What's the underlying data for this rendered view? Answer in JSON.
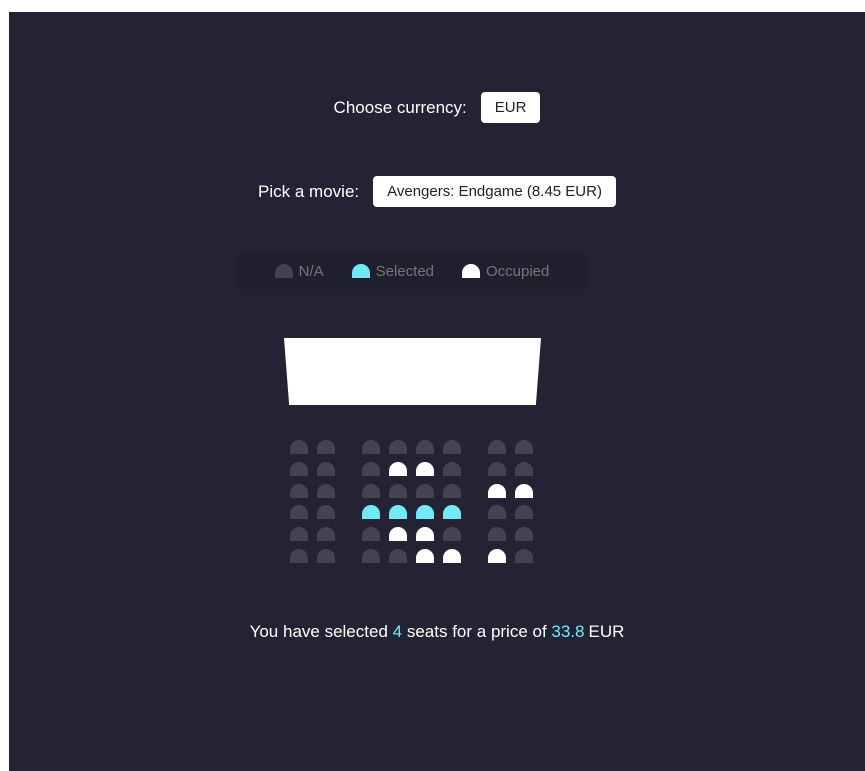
{
  "currency": {
    "label": "Choose currency:",
    "value": "EUR"
  },
  "movie": {
    "label": "Pick a movie:",
    "value": "Avengers: Endgame (8.45 EUR)"
  },
  "legend": [
    {
      "label": "N/A",
      "status": "na"
    },
    {
      "label": "Selected",
      "status": "selected"
    },
    {
      "label": "Occupied",
      "status": "occupied"
    }
  ],
  "seats": [
    [
      "na",
      "na",
      "na",
      "na",
      "na",
      "na",
      "na",
      "na"
    ],
    [
      "na",
      "na",
      "na",
      "occupied",
      "occupied",
      "na",
      "na",
      "na"
    ],
    [
      "na",
      "na",
      "na",
      "na",
      "na",
      "na",
      "occupied",
      "occupied"
    ],
    [
      "na",
      "na",
      "selected",
      "selected",
      "selected",
      "selected",
      "na",
      "na"
    ],
    [
      "na",
      "na",
      "na",
      "occupied",
      "occupied",
      "na",
      "na",
      "na"
    ],
    [
      "na",
      "na",
      "na",
      "na",
      "occupied",
      "occupied",
      "occupied",
      "na"
    ]
  ],
  "summary": {
    "prefix": "You have selected",
    "count": "4",
    "middle": "seats for a price of",
    "price": "33.8",
    "currency": "EUR"
  },
  "colors": {
    "background": "#242333",
    "seat_na": "#444451",
    "seat_selected": "#6feaf6",
    "seat_occupied": "#ffffff"
  }
}
